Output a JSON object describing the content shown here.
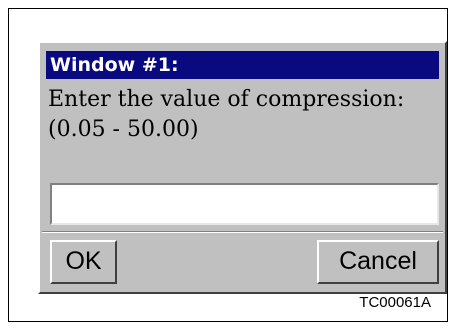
{
  "dialog": {
    "title": "Window #1:",
    "message_line1": "Enter the value of compression:",
    "message_line2": "(0.05 - 50.00)",
    "input_value": "",
    "ok_label": "OK",
    "cancel_label": "Cancel"
  },
  "figure": {
    "caption": "TC00061A"
  },
  "colors": {
    "titlebar": "#0a0a80",
    "dialog_bg": "#c0c0c0",
    "field_bg": "#ffffff"
  }
}
